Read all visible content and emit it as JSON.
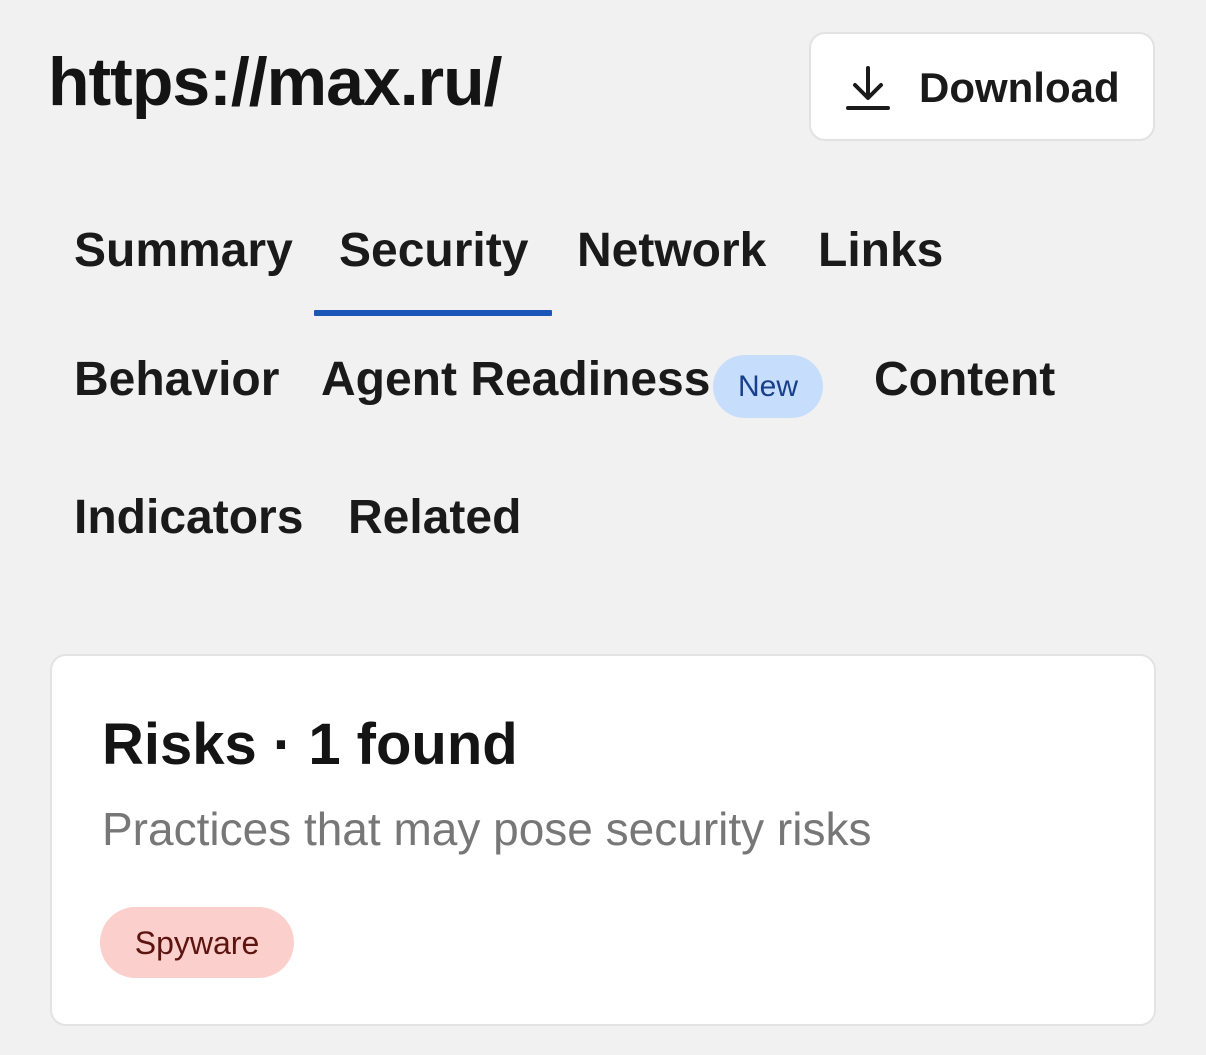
{
  "header": {
    "title": "https://max.ru/",
    "download_label": "Download",
    "download_icon": "download-icon"
  },
  "tabs": [
    {
      "label": "Summary",
      "active": false
    },
    {
      "label": "Security",
      "active": true
    },
    {
      "label": "Network",
      "active": false
    },
    {
      "label": "Links",
      "active": false
    },
    {
      "label": "Behavior",
      "active": false
    },
    {
      "label": "Agent Readiness",
      "active": false,
      "badge": "New"
    },
    {
      "label": "Content",
      "active": false
    },
    {
      "label": "Indicators",
      "active": false
    },
    {
      "label": "Related",
      "active": false
    }
  ],
  "risks": {
    "title": "Risks · 1 found",
    "subtitle": "Practices that may pose security risks",
    "tags": [
      {
        "label": "Spyware",
        "color": "#fbcfcb"
      }
    ]
  },
  "colors": {
    "accent": "#1b57b8",
    "badge_bg": "#c6ddfb",
    "risk_tag_bg": "#fbcfcb",
    "page_bg": "#f1f1f1"
  }
}
